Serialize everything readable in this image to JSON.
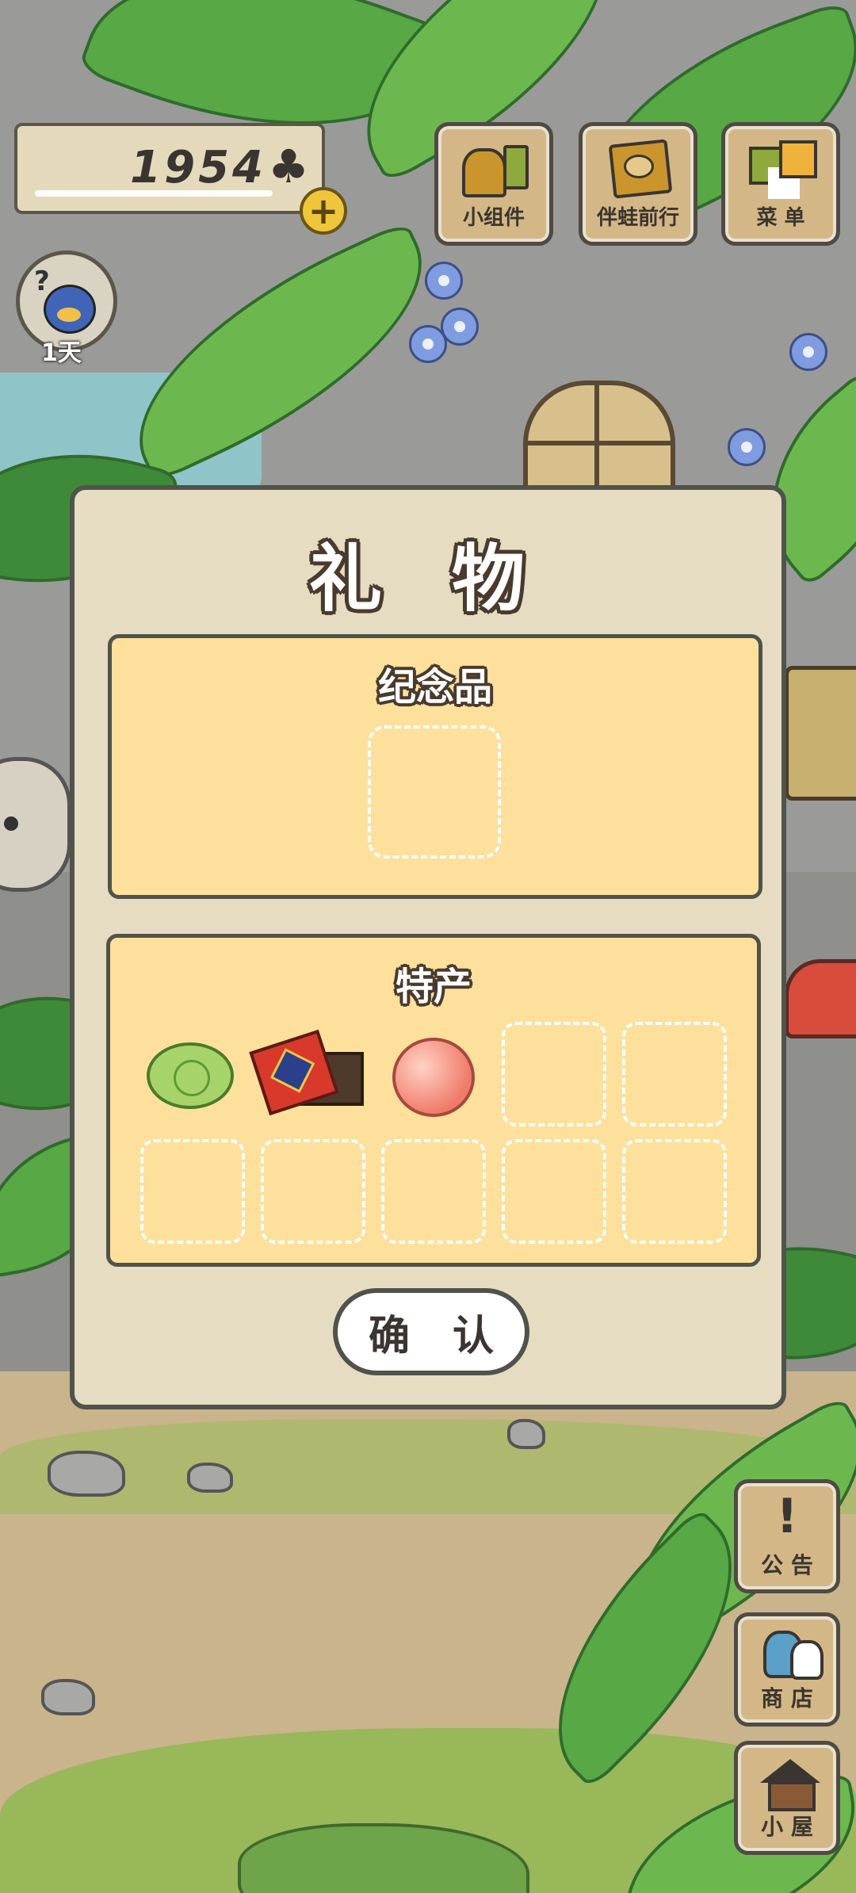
{
  "hud": {
    "clover_count": "1954",
    "clover_icon": "clover-icon",
    "add_button": "+",
    "visitor_days": "1天"
  },
  "top_buttons": [
    {
      "label": "小组件",
      "icon": "widget-icon"
    },
    {
      "label": "伴蛙前行",
      "icon": "frog-journey-icon"
    },
    {
      "label": "菜 单",
      "icon": "menu-icon"
    }
  ],
  "side_buttons": [
    {
      "label": "公 告",
      "icon": "notice-icon",
      "glyph": "!"
    },
    {
      "label": "商 店",
      "icon": "shop-icon"
    },
    {
      "label": "小 屋",
      "icon": "house-icon"
    }
  ],
  "dialog": {
    "title": "礼 物",
    "souvenir": {
      "title": "纪念品",
      "slots": 1
    },
    "specialty": {
      "title": "特产",
      "items": [
        "cabbage",
        "gift-box",
        "peach"
      ],
      "empty_slots": 7
    },
    "confirm_label": "确 认"
  },
  "colors": {
    "dialog_bg": "#e6dcc1",
    "panel_bg": "#fde09b",
    "outline": "#4f534c",
    "wood": "#d3b786"
  }
}
